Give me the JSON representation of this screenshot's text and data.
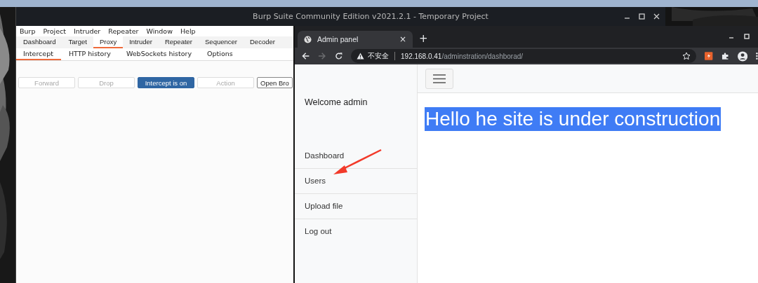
{
  "burp": {
    "title": "Burp Suite Community Edition v2021.2.1 - Temporary Project",
    "menu": [
      "Burp",
      "Project",
      "Intruder",
      "Repeater",
      "Window",
      "Help"
    ],
    "tabs": [
      {
        "label": "Dashboard",
        "selected": false
      },
      {
        "label": "Target",
        "selected": false
      },
      {
        "label": "Proxy",
        "selected": true
      },
      {
        "label": "Intruder",
        "selected": false
      },
      {
        "label": "Repeater",
        "selected": false
      },
      {
        "label": "Sequencer",
        "selected": false
      },
      {
        "label": "Decoder",
        "selected": false
      }
    ],
    "subtabs": [
      {
        "label": "Intercept",
        "selected": true
      },
      {
        "label": "HTTP history",
        "selected": false
      },
      {
        "label": "WebSockets history",
        "selected": false
      },
      {
        "label": "Options",
        "selected": false
      }
    ],
    "buttons": [
      {
        "label": "Forward",
        "kind": "disabled"
      },
      {
        "label": "Drop",
        "kind": "disabled"
      },
      {
        "label": "Intercept is on",
        "kind": "toggle_on"
      },
      {
        "label": "Action",
        "kind": "disabled"
      },
      {
        "label": "Open Bro",
        "kind": "normal"
      }
    ]
  },
  "browser": {
    "tab": {
      "title": "Admin panel",
      "close": "×"
    },
    "new_tab": "+",
    "forward_disabled": true,
    "address": {
      "security": "不安全",
      "host": "192.168.0.41",
      "path": "/adminstration/dashborad/"
    },
    "page": {
      "welcome": "Welcome admin",
      "nav": [
        {
          "label": "Dashboard"
        },
        {
          "label": "Users"
        },
        {
          "label": "Upload file"
        },
        {
          "label": "Log out"
        }
      ],
      "heading": "Hello he site is under construction",
      "heading_selected": true
    }
  }
}
